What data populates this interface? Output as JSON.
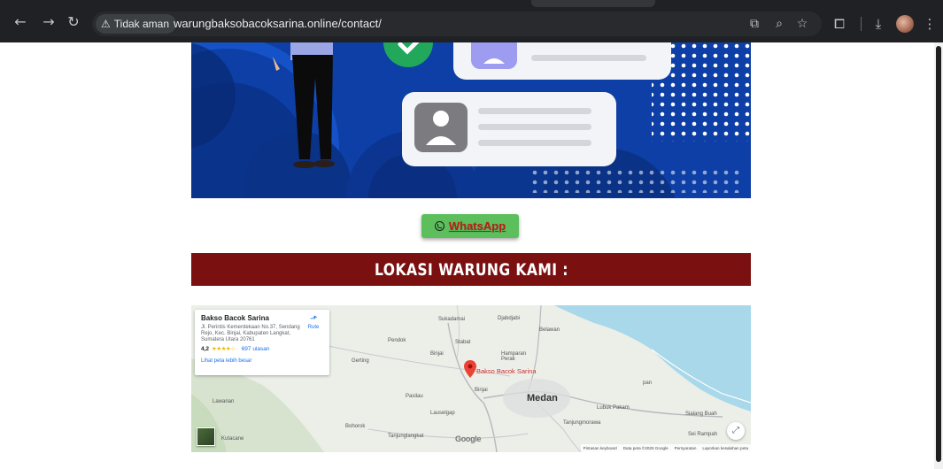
{
  "browser": {
    "security_label": "Tidak aman",
    "url": "warungbaksobacoksarina.online/contact/",
    "icons": [
      "back-icon",
      "forward-icon",
      "reload-icon",
      "warning-icon",
      "translate-icon",
      "zoom-icon",
      "bookmark-star-icon",
      "extensions-icon",
      "download-icon",
      "profile-avatar",
      "menu-icon"
    ]
  },
  "contact": {
    "whatsapp_label": "WhatsApp"
  },
  "section": {
    "title": "LOKASI WARUNG KAMI :"
  },
  "map": {
    "place_name": "Bakso Bacok Sarina",
    "address": "Jl. Perintis Kemerdekaan No.37, Sendang Rejo, Kec. Binjai, Kabupaten Langkat, Sumatera Utara 20761",
    "rating": "4,2",
    "stars": "★★★★☆",
    "reviews": "697 ulasan",
    "larger_map_link": "Lihat peta lebih besar",
    "directions_label": "Rute",
    "marker_label": "Bakso Bacok Sarina",
    "places": [
      {
        "name": "Sukadamai",
        "big": false
      },
      {
        "name": "Djabdjabi",
        "big": false
      },
      {
        "name": "Belawan",
        "big": false
      },
      {
        "name": "Pendok",
        "big": false
      },
      {
        "name": "Stabat",
        "big": false
      },
      {
        "name": "Binjai",
        "big": false
      },
      {
        "name": "Hamparan Perak",
        "big": false
      },
      {
        "name": "Gerting",
        "big": false
      },
      {
        "name": "Binjai",
        "big": false
      },
      {
        "name": "Pasilau",
        "big": false
      },
      {
        "name": "Medan",
        "big": true
      },
      {
        "name": "pan",
        "big": false
      },
      {
        "name": "Lawanan",
        "big": false
      },
      {
        "name": "Lubuk Pakam",
        "big": false
      },
      {
        "name": "Sialang Buah",
        "big": false
      },
      {
        "name": "Lauselgap",
        "big": false
      },
      {
        "name": "Tanjungmorawa",
        "big": false
      },
      {
        "name": "Bohorok",
        "big": false
      },
      {
        "name": "Tanjunglangkat",
        "big": false
      },
      {
        "name": "Sei Rampah",
        "big": false
      },
      {
        "name": "Kutacane",
        "big": false
      }
    ],
    "google_logo": "Google",
    "footer": [
      "Pintasan keyboard",
      "Data peta ©2025 Google",
      "Persyaratan",
      "Laporkan kesalahan peta"
    ]
  },
  "colors": {
    "chrome_bg": "#202124",
    "hero_blue": "#0d3fa6",
    "whatsapp_green": "#5cbf5c",
    "whatsapp_text": "#c11919",
    "banner_red": "#7a1010",
    "sea": "#a8d8ea"
  }
}
